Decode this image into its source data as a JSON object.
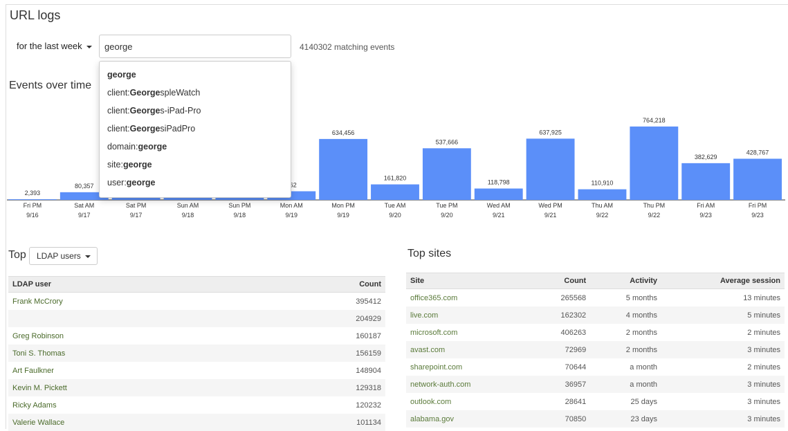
{
  "page": {
    "title": "URL logs"
  },
  "filter": {
    "range_label": "for the last week",
    "search_value": "george",
    "matching": "4140302 matching events"
  },
  "suggestions": [
    {
      "prefix": "",
      "bold": "george",
      "suffix": ""
    },
    {
      "prefix": "client:",
      "bold": "George",
      "suffix": "spleWatch"
    },
    {
      "prefix": "client:",
      "bold": "George",
      "suffix": "s-iPad-Pro"
    },
    {
      "prefix": "client:",
      "bold": "George",
      "suffix": "siPadPro"
    },
    {
      "prefix": "domain:",
      "bold": "george",
      "suffix": ""
    },
    {
      "prefix": "site:",
      "bold": "george",
      "suffix": ""
    },
    {
      "prefix": "user:",
      "bold": "george",
      "suffix": ""
    }
  ],
  "events": {
    "title": "Events over time"
  },
  "chart_data": {
    "type": "bar",
    "categories": [
      "Fri PM 9/16",
      "Sat AM 9/17",
      "Sat PM 9/17",
      "Sun AM 9/18",
      "Sun PM 9/18",
      "Mon AM 9/19",
      "Mon PM 9/19",
      "Tue AM 9/20",
      "Tue PM 9/20",
      "Wed AM 9/21",
      "Wed PM 9/21",
      "Thu AM 9/22",
      "Thu PM 9/22",
      "Fri AM 9/23",
      "Fri PM 9/23"
    ],
    "cat_line1": [
      "Fri PM",
      "Sat AM",
      "Sat PM",
      "Sun AM",
      "Sun PM",
      "Mon AM",
      "Mon PM",
      "Tue AM",
      "Tue PM",
      "Wed AM",
      "Wed PM",
      "Thu AM",
      "Thu PM",
      "Fri AM",
      "Fri PM"
    ],
    "cat_line2": [
      "9/16",
      "9/17",
      "9/17",
      "9/18",
      "9/18",
      "9/19",
      "9/19",
      "9/20",
      "9/20",
      "9/21",
      "9/21",
      "9/22",
      "9/22",
      "9/23",
      "9/23"
    ],
    "values": [
      2393,
      80357,
      70000,
      40000,
      30000,
      90162,
      634456,
      161820,
      537666,
      118798,
      637925,
      110910,
      764218,
      382629,
      428767
    ],
    "labels": [
      "2,393",
      "80,357",
      "",
      "",
      "",
      "162",
      "634,456",
      "161,820",
      "537,666",
      "118,798",
      "637,925",
      "110,910",
      "764,218",
      "382,629",
      "428,767"
    ],
    "ylim": [
      0,
      900000
    ],
    "color": "#5b8ff9"
  },
  "top": {
    "label": "Top",
    "select": "LDAP users"
  },
  "ldap_table": {
    "headers": [
      "LDAP user",
      "Count"
    ],
    "rows": [
      [
        "Frank McCrory",
        "395412"
      ],
      [
        "",
        "204929"
      ],
      [
        "Greg Robinson",
        "160187"
      ],
      [
        "Toni S. Thomas",
        "156159"
      ],
      [
        "Art Faulkner",
        "148904"
      ],
      [
        "Kevin M. Pickett",
        "129318"
      ],
      [
        "Ricky Adams",
        "120232"
      ],
      [
        "Valerie Wallace",
        "101134"
      ]
    ]
  },
  "sites": {
    "title": "Top sites",
    "headers": [
      "Site",
      "Count",
      "Activity",
      "Average session"
    ],
    "rows": [
      [
        "office365.com",
        "265568",
        "5 months",
        "13 minutes"
      ],
      [
        "live.com",
        "162302",
        "4 months",
        "5 minutes"
      ],
      [
        "microsoft.com",
        "406263",
        "2 months",
        "2 minutes"
      ],
      [
        "avast.com",
        "72969",
        "2 months",
        "3 minutes"
      ],
      [
        "sharepoint.com",
        "70644",
        "a month",
        "2 minutes"
      ],
      [
        "network-auth.com",
        "36957",
        "a month",
        "3 minutes"
      ],
      [
        "outlook.com",
        "28641",
        "25 days",
        "3 minutes"
      ],
      [
        "alabama.gov",
        "70850",
        "23 days",
        "3 minutes"
      ]
    ]
  }
}
